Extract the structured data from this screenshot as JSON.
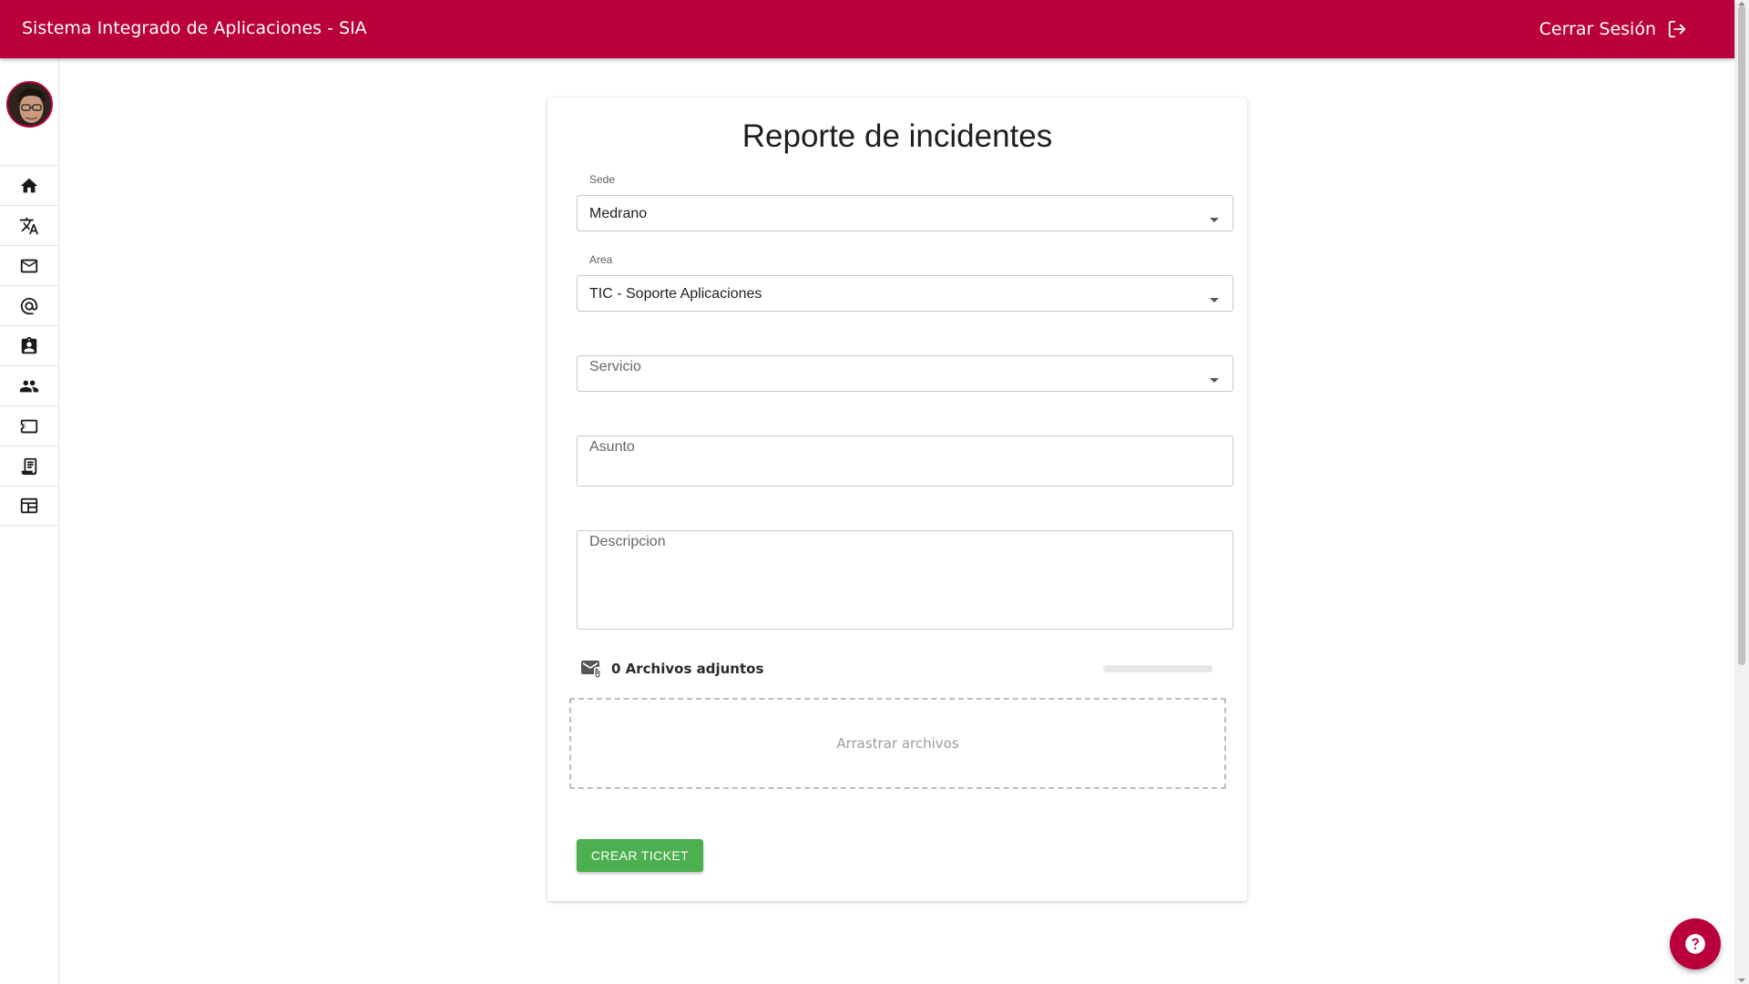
{
  "header": {
    "title": "Sistema Integrado de Aplicaciones - SIA",
    "logout_label": "Cerrar Sesión",
    "logout_icon": "logout-icon",
    "background_color": "#b9003a"
  },
  "sidebar": {
    "avatar": "user-avatar",
    "items": [
      {
        "icon": "home-icon"
      },
      {
        "icon": "translate-icon"
      },
      {
        "icon": "mail-icon"
      },
      {
        "icon": "at-sign-icon"
      },
      {
        "icon": "assignment-ind-icon"
      },
      {
        "icon": "people-icon"
      },
      {
        "icon": "ticket-icon"
      },
      {
        "icon": "receipt-icon"
      },
      {
        "icon": "table-icon"
      }
    ]
  },
  "form": {
    "title": "Reporte de incidentes",
    "sede": {
      "label": "Sede",
      "value": "Medrano"
    },
    "area": {
      "label": "Area",
      "value": "TIC - Soporte Aplicaciones"
    },
    "servicio": {
      "placeholder": "Servicio"
    },
    "asunto": {
      "placeholder": "Asunto"
    },
    "descripcion": {
      "placeholder": "Descripcion"
    },
    "attachments": {
      "label": "0 Archivos adjuntos",
      "icon": "mail-attachment-icon",
      "progress": 0
    },
    "dropzone_label": "Arrastrar archivos",
    "submit_label": "CREAR TICKET",
    "submit_color": "#4caf50"
  },
  "help_button": {
    "icon": "help-icon"
  }
}
